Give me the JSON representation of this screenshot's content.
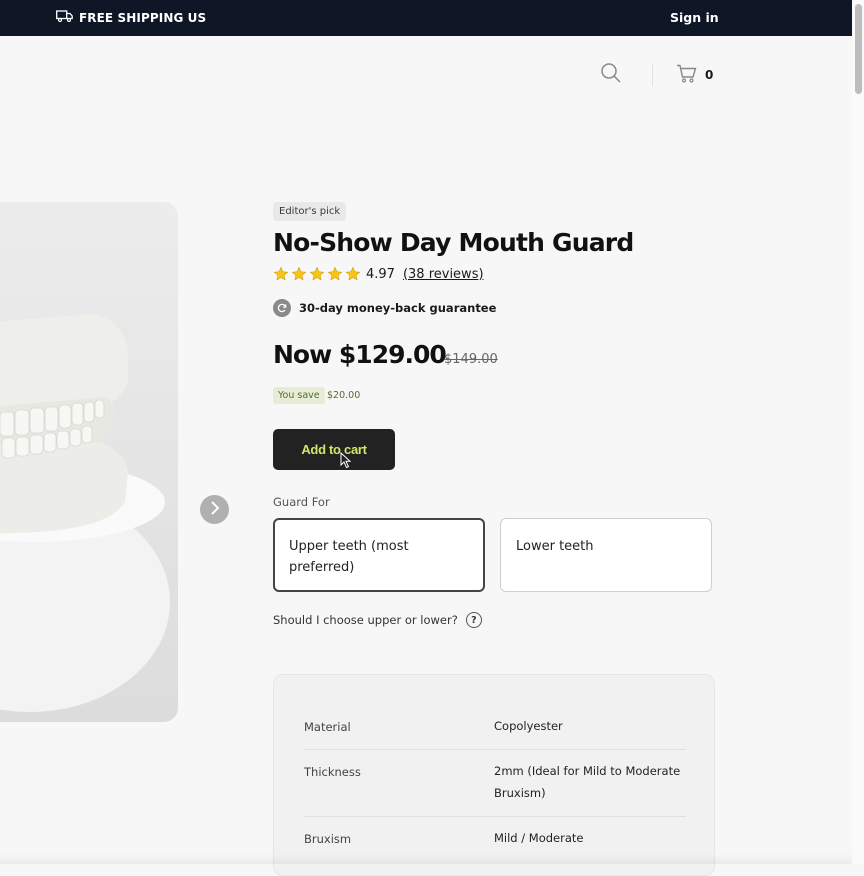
{
  "topbar": {
    "shipping_text": "FREE SHIPPING US",
    "signin_label": "Sign in"
  },
  "header": {
    "cart_count": "0"
  },
  "product": {
    "badge": "Editor's pick",
    "title": "No-Show Day Mouth Guard",
    "rating_value": "4.97",
    "rating_stars": 5,
    "reviews_link": "(38 reviews)",
    "guarantee": "30-day money-back guarantee",
    "price_now": "Now $129.00",
    "price_old": "$149.00",
    "save_label": "You save",
    "save_amount": "$20.00",
    "add_to_cart": "Add to cart",
    "guard_for_label": "Guard For",
    "options": [
      {
        "label": "Upper teeth (most preferred)",
        "selected": true
      },
      {
        "label": "Lower teeth",
        "selected": false
      }
    ],
    "help_text": "Should I choose upper or lower?",
    "help_icon": "?"
  },
  "specs": [
    {
      "key": "Material",
      "value": "Copolyester"
    },
    {
      "key": "Thickness",
      "value": "2mm (Ideal for Mild to Moderate Bruxism)"
    },
    {
      "key": "Bruxism",
      "value": "Mild / Moderate"
    }
  ],
  "colors": {
    "topbar_bg": "#0f1626",
    "cart_button_bg": "#222222",
    "cart_button_text": "#cfe86a",
    "star": "#f5c518",
    "save_chip_bg": "#e6ecd6"
  }
}
